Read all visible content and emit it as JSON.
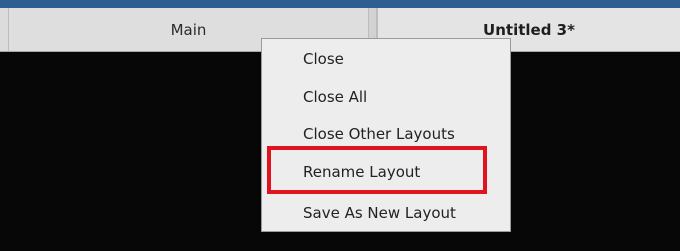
{
  "tabs": [
    {
      "label": "Main",
      "active": false
    },
    {
      "label": "Untitled 3*",
      "active": true
    }
  ],
  "context_menu": {
    "items": [
      {
        "label": "Close"
      },
      {
        "label": "Close All"
      },
      {
        "label": "Close Other Layouts"
      },
      {
        "label": "Rename Layout",
        "highlighted": true
      },
      {
        "label": "Save As New Layout"
      }
    ]
  },
  "colors": {
    "title_strip": "#2f5f92",
    "tab_bar": "#dcdcdc",
    "workspace": "#070707",
    "menu_background": "#ededed",
    "highlight_border": "#e0141e"
  }
}
